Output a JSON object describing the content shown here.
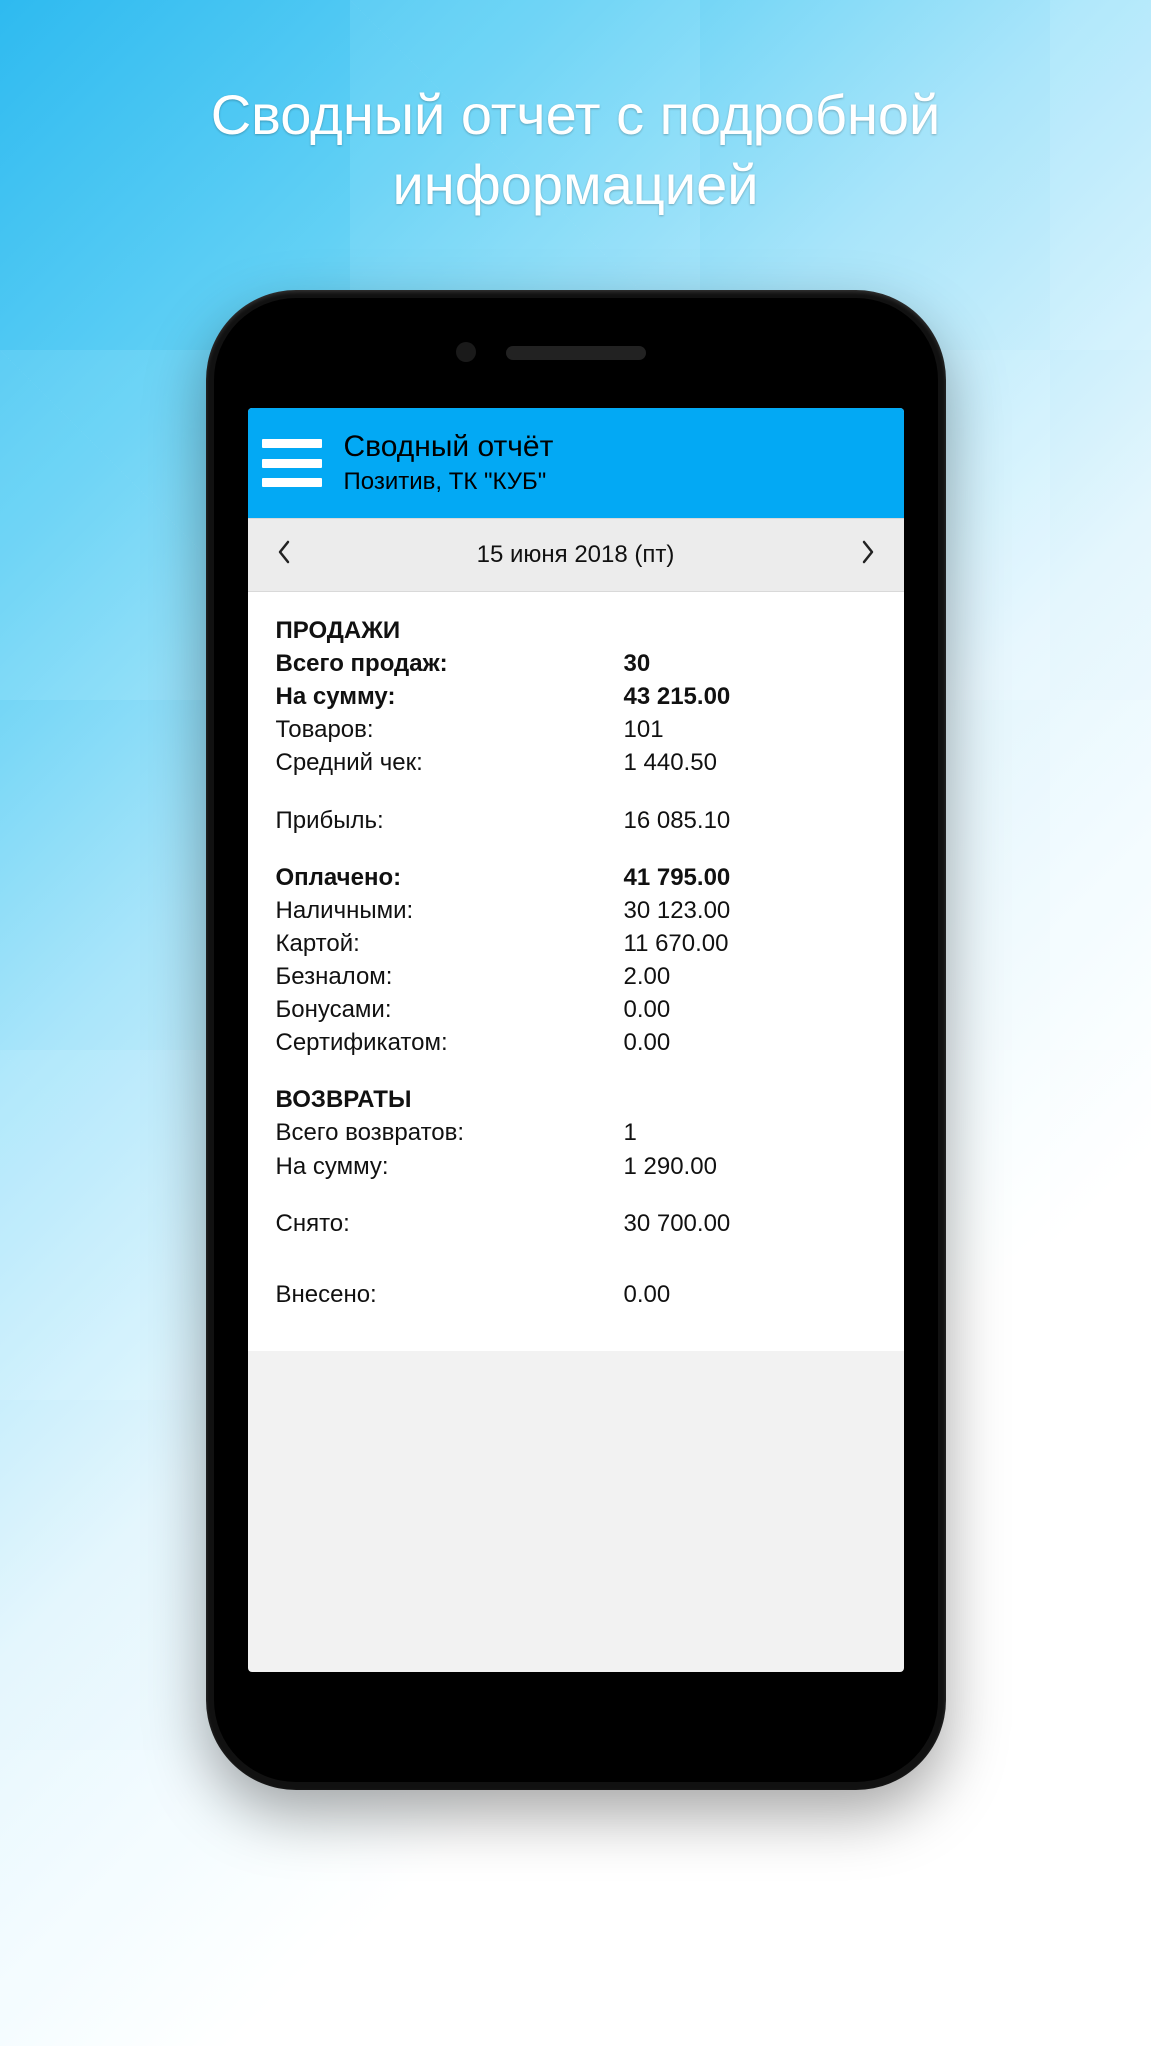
{
  "promo": {
    "title_line1": "Сводный отчет с подробной",
    "title_line2": "информацией"
  },
  "appbar": {
    "title": "Сводный отчёт",
    "subtitle": "Позитив, ТК \"КУБ\""
  },
  "datebar": {
    "date": "15 июня 2018 (пт)"
  },
  "report": {
    "sales": {
      "header": "ПРОДАЖИ",
      "total_sales_label": "Всего продаж:",
      "total_sales_value": "30",
      "amount_label": "На сумму:",
      "amount_value": "43 215.00",
      "items_label": "Товаров:",
      "items_value": "101",
      "avg_check_label": "Средний чек:",
      "avg_check_value": "1 440.50",
      "profit_label": "Прибыль:",
      "profit_value": "16 085.10",
      "paid_label": "Оплачено:",
      "paid_value": "41 795.00",
      "cash_label": "Наличными:",
      "cash_value": "30 123.00",
      "card_label": "Картой:",
      "card_value": "11 670.00",
      "wire_label": "Безналом:",
      "wire_value": "2.00",
      "bonus_label": "Бонусами:",
      "bonus_value": "0.00",
      "cert_label": "Сертификатом:",
      "cert_value": "0.00"
    },
    "returns": {
      "header": "ВОЗВРАТЫ",
      "total_label": "Всего возвратов:",
      "total_value": "1",
      "amount_label": "На сумму:",
      "amount_value": "1 290.00"
    },
    "withdrawn": {
      "label": "Снято:",
      "value": "30 700.00"
    },
    "deposited": {
      "label": "Внесено:",
      "value": "0.00"
    }
  }
}
